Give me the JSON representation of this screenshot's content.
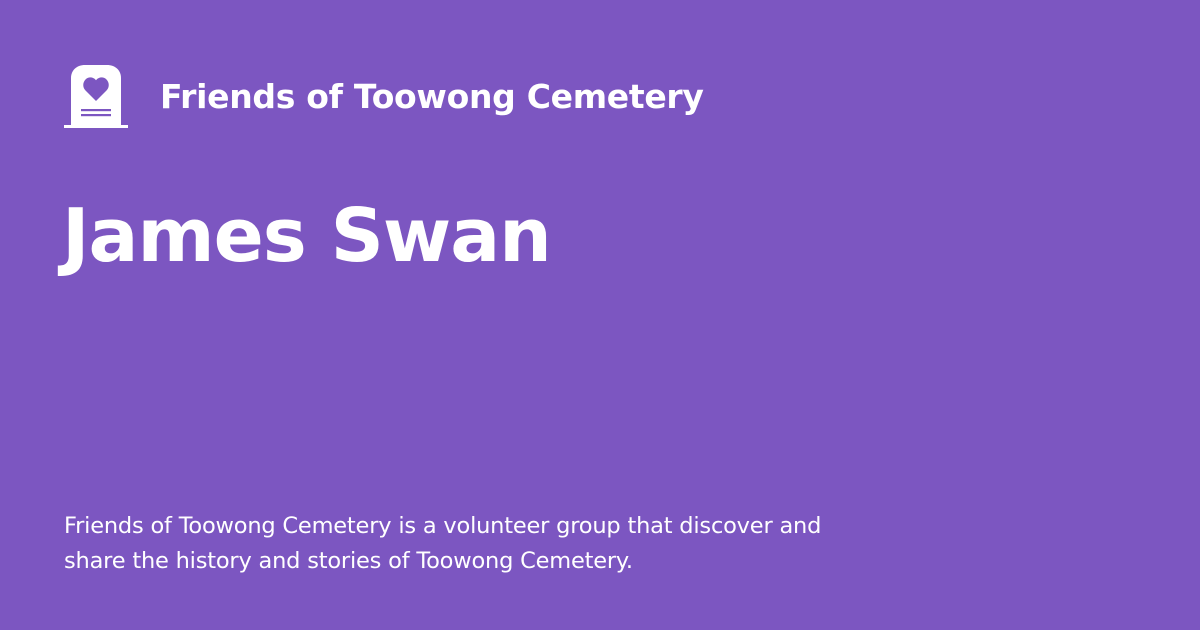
{
  "header": {
    "logo_icon": "gravestone-heart-icon",
    "org_name": "Friends of Toowong Cemetery"
  },
  "page": {
    "title": "James Swan",
    "description": "Friends of Toowong Cemetery is a volunteer group that discover and share the history and stories of Toowong Cemetery."
  },
  "colors": {
    "background": "#7c56c1",
    "text": "#ffffff"
  }
}
